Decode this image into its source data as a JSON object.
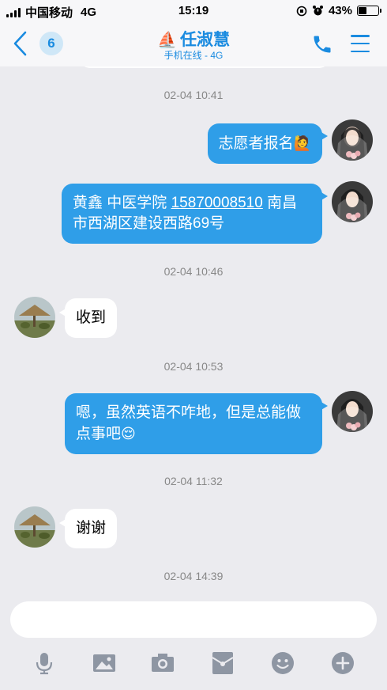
{
  "status_bar": {
    "carrier": "中国移动",
    "network": "4G",
    "time": "15:19",
    "battery": "43%",
    "battery_level": 0.43
  },
  "nav": {
    "unread_count": "6",
    "contact_name": "任淑慧",
    "contact_status": "手机在线 - 4G",
    "accent_color": "#1a8be0"
  },
  "messages": [
    {
      "type": "timestamp",
      "text": "02-04 10:41"
    },
    {
      "type": "out",
      "text": "志愿者报名",
      "emoji": "🙋"
    },
    {
      "type": "out",
      "text_before": "黄鑫 中医学院 ",
      "phone": "15870008510",
      "text_after": " 南昌市西湖区建设西路69号"
    },
    {
      "type": "timestamp",
      "text": "02-04 10:46"
    },
    {
      "type": "in",
      "text": "收到"
    },
    {
      "type": "timestamp",
      "text": "02-04 10:53"
    },
    {
      "type": "out",
      "text": "嗯，虽然英语不咋地，但是总能做点事吧",
      "emoji": "😌"
    },
    {
      "type": "timestamp",
      "text": "02-04 11:32"
    },
    {
      "type": "in",
      "text": "谢谢"
    },
    {
      "type": "timestamp",
      "text": "02-04 14:39"
    }
  ],
  "input": {
    "placeholder": ""
  },
  "toolbar": [
    "microphone-icon",
    "image-icon",
    "camera-icon",
    "red-packet-icon",
    "emoji-icon",
    "plus-icon"
  ],
  "colors": {
    "bubble_out": "#2f9ee8",
    "bubble_in": "#ffffff",
    "background": "#ebebef"
  }
}
